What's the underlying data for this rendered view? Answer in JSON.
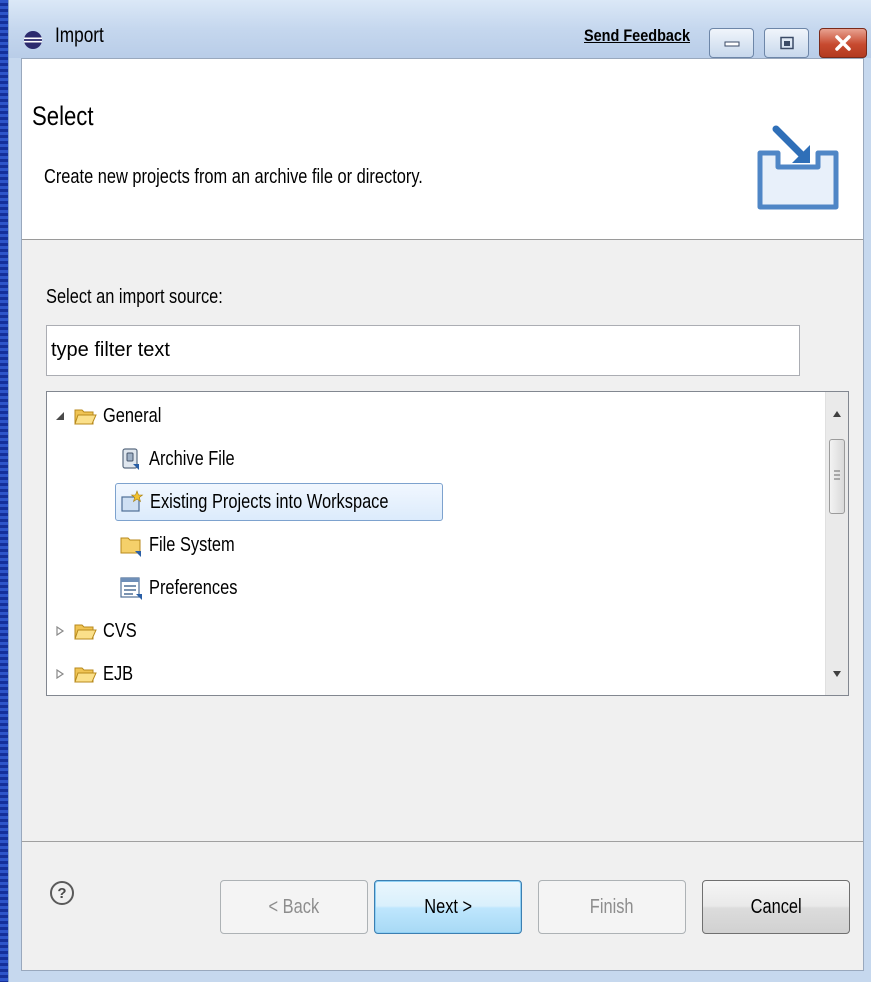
{
  "window": {
    "title": "Import",
    "feedback_label": "Send Feedback"
  },
  "header": {
    "title": "Select",
    "description": "Create new projects from an archive file or directory."
  },
  "source": {
    "label": "Select an import source:",
    "filter_value": "",
    "filter_placeholder": "type filter text"
  },
  "tree": {
    "items": [
      {
        "label": "General",
        "icon": "folder-open-icon",
        "expanded": true
      },
      {
        "label": "Archive File",
        "icon": "archive-file-icon"
      },
      {
        "label": "Existing Projects into Workspace",
        "icon": "project-icon",
        "selected": true
      },
      {
        "label": "File System",
        "icon": "folder-icon"
      },
      {
        "label": "Preferences",
        "icon": "preferences-icon"
      },
      {
        "label": "CVS",
        "icon": "folder-open-icon",
        "expanded": false
      },
      {
        "label": "EJB",
        "icon": "folder-open-icon",
        "expanded": false
      }
    ]
  },
  "buttons": {
    "back": "< Back",
    "next": "Next >",
    "finish": "Finish",
    "cancel": "Cancel"
  },
  "colors": {
    "close_button": "#c74a2f",
    "selection_border": "#7da2ce",
    "title_bar": "#c5d7ee"
  }
}
